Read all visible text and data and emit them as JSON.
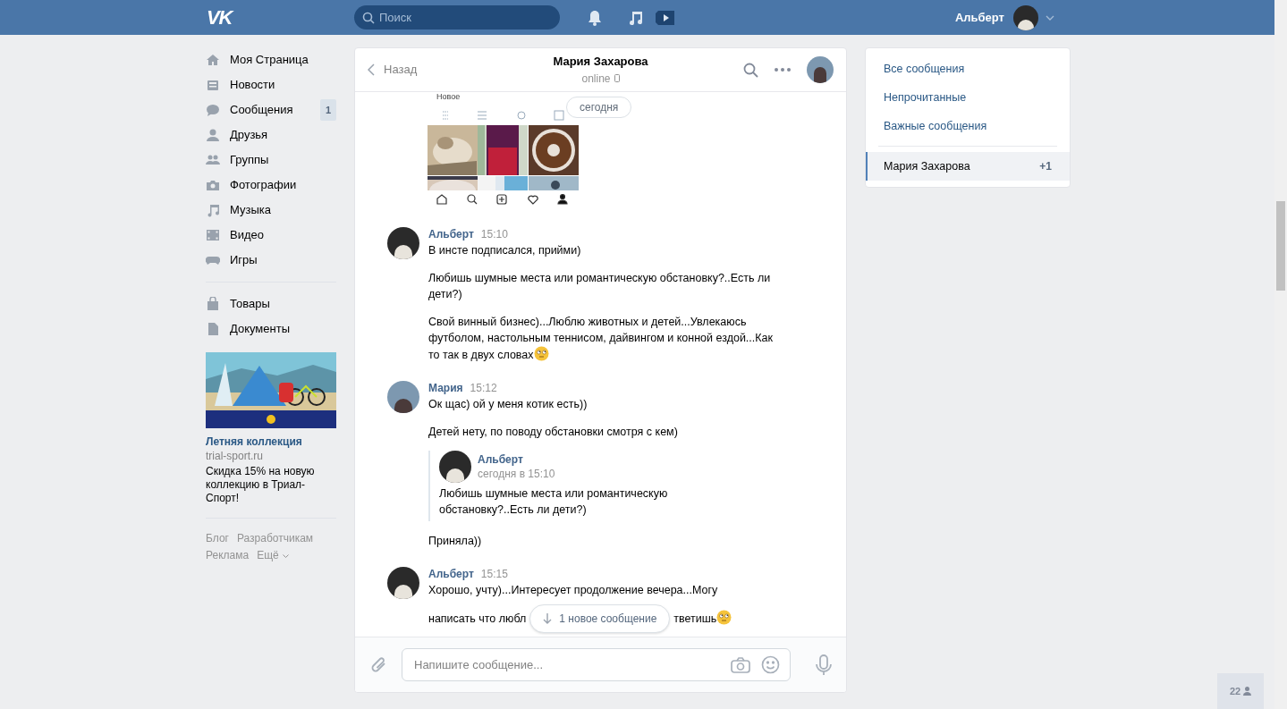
{
  "header": {
    "logo_text": "VK",
    "search": {
      "placeholder": "Поиск"
    },
    "user_name": "Альберт"
  },
  "nav": {
    "items": [
      {
        "label": "Моя Страница"
      },
      {
        "label": "Новости"
      },
      {
        "label": "Сообщения",
        "count": "1"
      },
      {
        "label": "Друзья"
      },
      {
        "label": "Группы"
      },
      {
        "label": "Фотографии"
      },
      {
        "label": "Музыка"
      },
      {
        "label": "Видео"
      },
      {
        "label": "Игры"
      }
    ],
    "extra_items": [
      {
        "label": "Товары"
      },
      {
        "label": "Документы"
      }
    ],
    "ad": {
      "title": "Летняя коллекция",
      "domain": "trial-sport.ru",
      "text": "Скидка 15% на новую коллекцию в Триал-Спорт!"
    },
    "footer_links": [
      "Блог",
      "Разработчикам",
      "Реклама",
      "Ещё"
    ]
  },
  "chat": {
    "back": "Назад",
    "title": "Мария Захарова",
    "status": "online",
    "screenshot": {
      "caption": "Новое"
    },
    "date_badge": "сегодня",
    "messages": [
      {
        "author": "Альберт",
        "time": "15:10",
        "paragraphs": [
          {
            "kind": "text",
            "text": "В инсте подписался, прийми)"
          },
          {
            "kind": "text",
            "text": "Любишь шумные места или романтическую обстановку?..Есть ли дети?)"
          },
          {
            "kind": "text",
            "text": "Свой винный бизнес)...Люблю животных и детей...Увлекаюсь футболом, настольным теннисом, дайвингом и конной ездой...Как то так в двух словах",
            "emoji": true
          }
        ]
      },
      {
        "author": "Мария",
        "time": "15:12",
        "paragraphs": [
          {
            "kind": "text",
            "text": "Ок щас) ой у меня котик есть))"
          },
          {
            "kind": "text",
            "text": "Детей нету, по поводу обстановки смотря с кем)"
          },
          {
            "kind": "quote",
            "author": "Альберт",
            "time": "сегодня в 15:10",
            "text": "Любишь шумные места или романтическую обстановку?..Есть ли дети?)"
          },
          {
            "kind": "text",
            "text": "Приняла))"
          }
        ]
      },
      {
        "author": "Альберт",
        "time": "15:15",
        "paragraphs": [
          {
            "kind": "text",
            "text": "Хорошо, учту)...Интересует продолжение вечера...Могу"
          },
          {
            "kind": "covered",
            "parts": [
              "написать что любл",
              "тветишь"
            ],
            "emoji": true
          }
        ]
      }
    ],
    "new_messages_button": "1 новое сообщение",
    "compose": {
      "placeholder": "Напишите сообщение..."
    }
  },
  "right_panel": {
    "filters": [
      {
        "label": "Все сообщения"
      },
      {
        "label": "Непрочитанные"
      },
      {
        "label": "Важные сообщения"
      }
    ],
    "conversations": [
      {
        "name": "Мария Захарова",
        "badge": "+1",
        "selected": true
      }
    ]
  },
  "online_friends": {
    "count": "22"
  }
}
